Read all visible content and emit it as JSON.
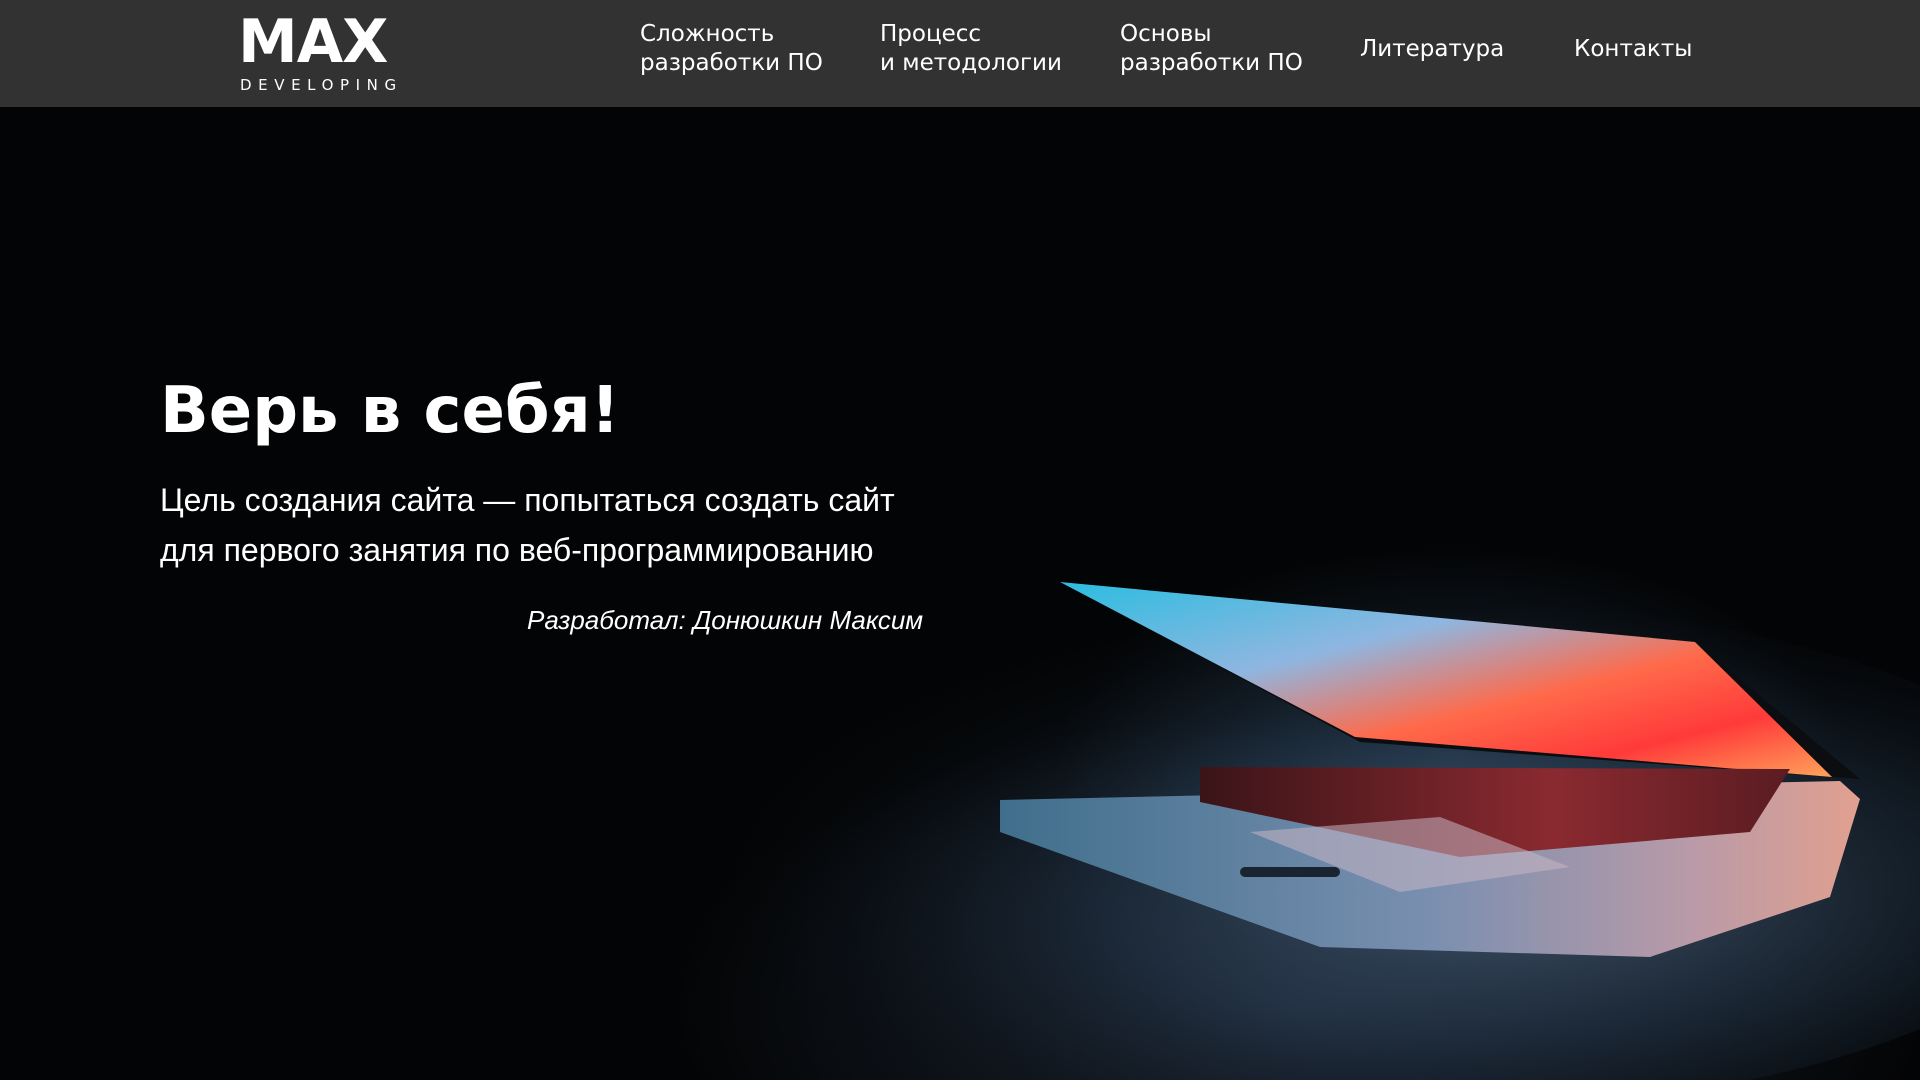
{
  "brand": {
    "name": "MAX",
    "tagline": "DEVELOPING"
  },
  "nav": {
    "items": [
      {
        "line1": "Сложность",
        "line2": "разработки ПО"
      },
      {
        "line1": "Процесс",
        "line2": "и методологии"
      },
      {
        "line1": "Основы",
        "line2": "разработки ПО"
      },
      {
        "line1": "Литература",
        "line2": ""
      },
      {
        "line1": "Контакты",
        "line2": ""
      }
    ]
  },
  "hero": {
    "headline": "Верь в себя!",
    "subtitle_line1": "Цель создания сайта — попытаться создать сайт",
    "subtitle_line2": "для первого занятия по веб-программированию",
    "author": "Разработал: Донюшкин Максим",
    "image": "laptop-photo"
  },
  "colors": {
    "header_bg": "#323232",
    "hero_bg": "#030405",
    "text": "#ffffff"
  }
}
